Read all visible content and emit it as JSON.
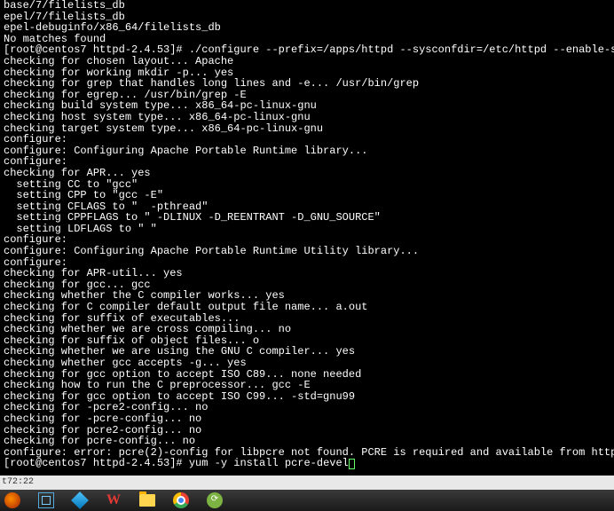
{
  "terminal": {
    "lines": [
      "base/7/filelists_db",
      "epel/7/filelists_db",
      "epel-debuginfo/x86_64/filelists_db",
      "No matches found",
      "[root@centos7 httpd-2.4.53]# ./configure --prefix=/apps/httpd --sysconfdir=/etc/httpd --enable-ssl",
      "checking for chosen layout... Apache",
      "checking for working mkdir -p... yes",
      "checking for grep that handles long lines and -e... /usr/bin/grep",
      "checking for egrep... /usr/bin/grep -E",
      "checking build system type... x86_64-pc-linux-gnu",
      "checking host system type... x86_64-pc-linux-gnu",
      "checking target system type... x86_64-pc-linux-gnu",
      "configure:",
      "configure: Configuring Apache Portable Runtime library...",
      "configure:",
      "checking for APR... yes",
      "  setting CC to \"gcc\"",
      "  setting CPP to \"gcc -E\"",
      "  setting CFLAGS to \"  -pthread\"",
      "  setting CPPFLAGS to \" -DLINUX -D_REENTRANT -D_GNU_SOURCE\"",
      "  setting LDFLAGS to \" \"",
      "configure:",
      "configure: Configuring Apache Portable Runtime Utility library...",
      "configure:",
      "checking for APR-util... yes",
      "checking for gcc... gcc",
      "checking whether the C compiler works... yes",
      "checking for C compiler default output file name... a.out",
      "checking for suffix of executables...",
      "checking whether we are cross compiling... no",
      "checking for suffix of object files... o",
      "checking whether we are using the GNU C compiler... yes",
      "checking whether gcc accepts -g... yes",
      "checking for gcc option to accept ISO C89... none needed",
      "checking how to run the C preprocessor... gcc -E",
      "checking for gcc option to accept ISO C99... -std=gnu99",
      "checking for -pcre2-config... no",
      "checking for -pcre-config... no",
      "checking for pcre2-config... no",
      "checking for pcre-config... no",
      "configure: error: pcre(2)-config for libpcre not found. PCRE is required and available from http://pcre.org/"
    ],
    "prompt": "[root@centos7 httpd-2.4.53]# ",
    "current_command": "yum -y install pcre-devel"
  },
  "statusbar": {
    "text": "t72:22"
  },
  "taskbar": {
    "items": [
      "start",
      "virtualbox",
      "app",
      "wps",
      "files",
      "chrome",
      "green"
    ]
  }
}
